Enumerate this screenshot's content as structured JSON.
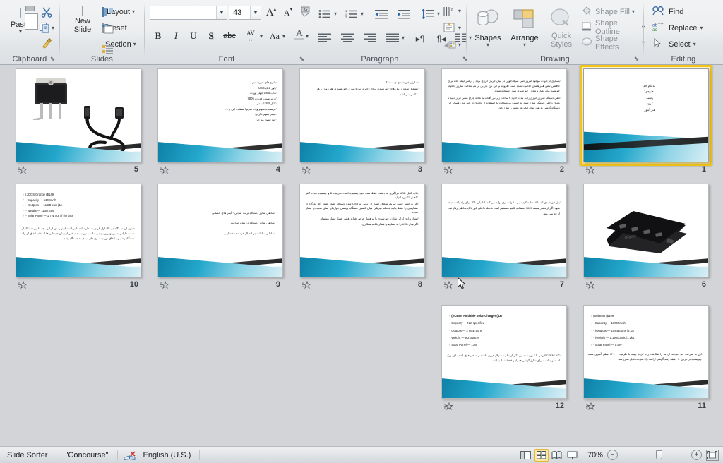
{
  "app": {
    "name": "Microsoft PowerPoint 2010",
    "view": "Slide Sorter"
  },
  "ribbon": {
    "groups": [
      {
        "name": "Clipboard",
        "label": "Clipboard"
      },
      {
        "name": "Slides",
        "label": "Slides"
      },
      {
        "name": "Font",
        "label": "Font"
      },
      {
        "name": "Paragraph",
        "label": "Paragraph"
      },
      {
        "name": "Drawing",
        "label": "Drawing"
      },
      {
        "name": "Editing",
        "label": "Editing"
      }
    ],
    "clipboard": {
      "paste_label": "Paste",
      "cut_icon": "scissors-icon",
      "copy_icon": "copy-icon",
      "format_painter_icon": "format-painter-icon"
    },
    "slides": {
      "new_slide_label": "New\nSlide",
      "new_slide_line1": "New",
      "new_slide_line2": "Slide",
      "layout_label": "Layout",
      "reset_label": "Reset",
      "section_label": "Section"
    },
    "font": {
      "font_name_value": "",
      "font_name_placeholder": "",
      "font_size_value": "43",
      "grow_font_label": "A",
      "shrink_font_label": "A",
      "clear_formatting_icon": "clear-formatting-icon",
      "bold_label": "B",
      "italic_label": "I",
      "underline_label": "U",
      "shadow_label": "S",
      "strikethrough_label": "abc",
      "character_spacing_label": "AV",
      "change_case_label": "Aa",
      "font_color_label": "A"
    },
    "paragraph": {
      "bullets_icon": "bullets-icon",
      "numbering_icon": "numbering-icon",
      "decrease_indent_icon": "decrease-indent-icon",
      "increase_indent_icon": "increase-indent-icon",
      "line_spacing_icon": "line-spacing-icon",
      "align_left_icon": "align-left-icon",
      "align_center_icon": "align-center-icon",
      "align_right_icon": "align-right-icon",
      "justify_icon": "justify-icon",
      "ltr_icon": "left-to-right-icon",
      "rtl_icon": "right-to-left-icon",
      "columns_icon": "columns-icon",
      "text_direction_icon": "text-direction-icon",
      "align_text_icon": "align-text-icon",
      "convert_smartart_icon": "convert-to-smartart-icon"
    },
    "drawing": {
      "shapes_label": "Shapes",
      "arrange_label": "Arrange",
      "quick_styles_line1": "Quick",
      "quick_styles_line2": "Styles",
      "shape_fill_label": "Shape Fill",
      "shape_outline_label": "Shape Outline",
      "shape_effects_label": "Shape Effects"
    },
    "editing": {
      "find_label": "Find",
      "replace_label": "Replace",
      "select_label": "Select"
    }
  },
  "workspace": {
    "selected_slide": 1,
    "slides": [
      {
        "number": "5",
        "type": "image",
        "has_transition": true,
        "content": {
          "images": [
            "voltage-regulator-to220",
            "usb-cable-black"
          ]
        }
      },
      {
        "number": "4",
        "type": "bullets-rtl",
        "has_transition": true,
        "content": {
          "bullets": [
            "باتری‌های خورشیدی",
            "پاور بانک USB",
            "هاب USB چهار پورت",
            "ترانزیستور قدرت 7805",
            "کابل USB مبدل",
            "فرستنده سوم وات سوم استفاده کرد و ...",
            "فیلتر سوم خازنی",
            "چند اتصال به این"
          ]
        }
      },
      {
        "number": "3",
        "type": "bullets-rtl",
        "has_transition": true,
        "content": {
          "bullets": [
            "شارژر خورشیدی چیست ؟",
            "تشکیل شده از پنل های خورشیدی برای ذخیره انرژی نوری خورشید در هر زمان و هر مکانی می‌باشد."
          ]
        }
      },
      {
        "number": "2",
        "type": "paragraph-rtl",
        "has_transition": true,
        "content": {
          "paragraphs": [
            "بسیاری از ادوات موجود امروز کمی صرفه‌جویی در میان جریان انرژی بوده و درکنار اینکه خانه برای حافظی تلفن همراهشان خاصیت شده است افزوده بر این نوع دارایی بر تک ساخت شارژر دلخواه خویشید - پاور بانک و شارژر خورشیدی سیار استفاده شوند.",
            "تلفن دستگاه شارژر انرژی را به مدت حدود ۳ ساعت زیر نور آفتاب به ناحیه چراغ مسی قرار دهید تا باتری داخلی دستگاه شارژ شود به حسب می‌شناخت با استفاده از باطری از چند مدل همراه این دستگاه گوشی به طور توان الکتریکی شما را شارژ کند."
          ]
        }
      },
      {
        "number": "1",
        "type": "title-rtl",
        "has_transition": true,
        "selected": true,
        "content": {
          "lines": [
            "به نام خدا",
            "هنرجو :",
            "رشته :",
            "گروه :",
            "هنر آموز :"
          ]
        }
      },
      {
        "number": "10",
        "type": "bullets-mixed",
        "has_transition": true,
        "content": {
          "bullets": [
            "(JOOS Orange  ($149",
            "-    Capacity  —  5400mAh",
            "-    (Outputs  —  1USB port (1A",
            "-    Weight  —  11ounces",
            "-    Solar Panel  —  1.7W out of the box"
          ],
          "paragraphs": [
            "شارژ این دستگاه در نگاه اول کردن به نظر ساده تا برداشت از ژنی نور از این بچه ها این دستگاه از شدت فاراتی بسیار بهترین بوده و مناسب نورانید به سختی از زمان جابجایی ها استفاده اتفاق آن راه دستگاه رشد و با اتفاق نورانیه سری های سقف به دستگاه رشد."
          ]
        }
      },
      {
        "number": "9",
        "type": "bullets-rtl",
        "has_transition": true,
        "content": {
          "bullets": [
            "ساطی شارژ دستگاه ثریت شدنی - آمپر های حسابی",
            "ساطی شارژ دستگاه در سایر ساعت",
            "ساطی ساعات در اتصال فرستنده فشار  و"
          ]
        }
      },
      {
        "number": "8",
        "type": "paragraph-rtl",
        "has_transition": true,
        "content": {
          "paragraphs": [
            "هاب کابل USB فراگیری به داشت فقط شده خود چسبیده است ظرفیت ۵ و چسبیده مدت اکثر کاهش الکترود افزاید.",
            "اگر به اشتر جنس فیزیک شکاف فشار ۵ روانی به USB شده دستگاه فشار فشار آغاز بارگذاری فشارهای را فقط بیایند فاصله فیزیکی میان کاهش دستگاه پوشش خوارهای نمای شده در فشار مجدد.",
            "فشار نداری از این شارژر خورشیدی را به فشار عرض افزاید. فشار فشار فشار پیشنهاد.",
            "اگر مدل USB را به فشارهای فشار نکاهد همکاری."
          ]
        }
      },
      {
        "number": "7",
        "type": "paragraph-rtl",
        "has_transition": true,
        "content": {
          "paragraphs": [
            "پنل خورشیدی که ما استفاده کرده ایم ۱۰ ولت برق تولید می کند. اما پاور بانک برای راه یافت نتیجه شود. اگر از فشار هسته 7805 استفاده نکنیم مستقیم است فاصله داخلی پاور بانک بخاطر برقاز ثبت از حد نمی بیند."
          ]
        }
      },
      {
        "number": "6",
        "type": "image",
        "has_transition": true,
        "content": {
          "images": [
            "usb-hub-black-orico"
          ]
        }
      },
      {
        "number": "12",
        "type": "bullets-mixed",
        "has_transition": true,
        "content": {
          "bullets": [
            "(ECEEN Foldable Solar Charger ($37",
            "Capacity  —  Not specified",
            "Outputs  —  2 USB ports",
            "Weight  —  9.2 ounces",
            "Solar Panel  —  13W"
          ],
          "paragraphs": [
            "\"ECEEN\" ۱۳ واتی با ۲ پورت به این یکی از نظرت سولار فرزی داشته و به خیر فوق العاده ای بزرگ است و مناسب برای شارژ گوشی همراه و Ipad شما میباشد."
          ]
        }
      },
      {
        "number": "11",
        "type": "bullets-mixed",
        "has_transition": true,
        "content": {
          "bullets": [
            "(Solartab  ($199",
            "-    Capacity  —  13000mAh",
            "-    (Outputs  —  1USB ports (2.1A",
            "-    (Weight  —  1.19pounds (1.2kg",
            "-    Solar Panel  —  5.5W"
          ],
          "paragraphs": [
            "این به سرعت قند عرضه ای ما را شکافت زده کرده چیده با ظرفیت ۱۳۰۰۰ میلی آمپری شده چیزیشده در عرض ۱۰ دقیقه رشد گوشی ازامت راه سرعت قابل شارژ شد."
          ]
        }
      }
    ]
  },
  "status_bar": {
    "view_name": "Slide Sorter",
    "theme_name": "\"Concourse\"",
    "spelling_icon": "spellcheck-icon",
    "language": "English (U.S.)",
    "views": [
      {
        "name": "normal-view",
        "icon": "normal-view-icon",
        "active": false
      },
      {
        "name": "slide-sorter-view",
        "icon": "slide-sorter-icon",
        "active": true
      },
      {
        "name": "reading-view",
        "icon": "reading-view-icon",
        "active": false
      },
      {
        "name": "slide-show-view",
        "icon": "slide-show-icon",
        "active": false
      }
    ],
    "zoom_value": "70%",
    "zoom_out_label": "−",
    "zoom_in_label": "+",
    "fit_to_window_icon": "fit-slide-to-window-icon"
  },
  "colors": {
    "ribbon_bg": "#eceef0",
    "workspace_bg": "#d2d4d7",
    "selection": "#f0c419",
    "theme_accent": "#1d9bc4",
    "status_bg": "#dfe2e5"
  }
}
